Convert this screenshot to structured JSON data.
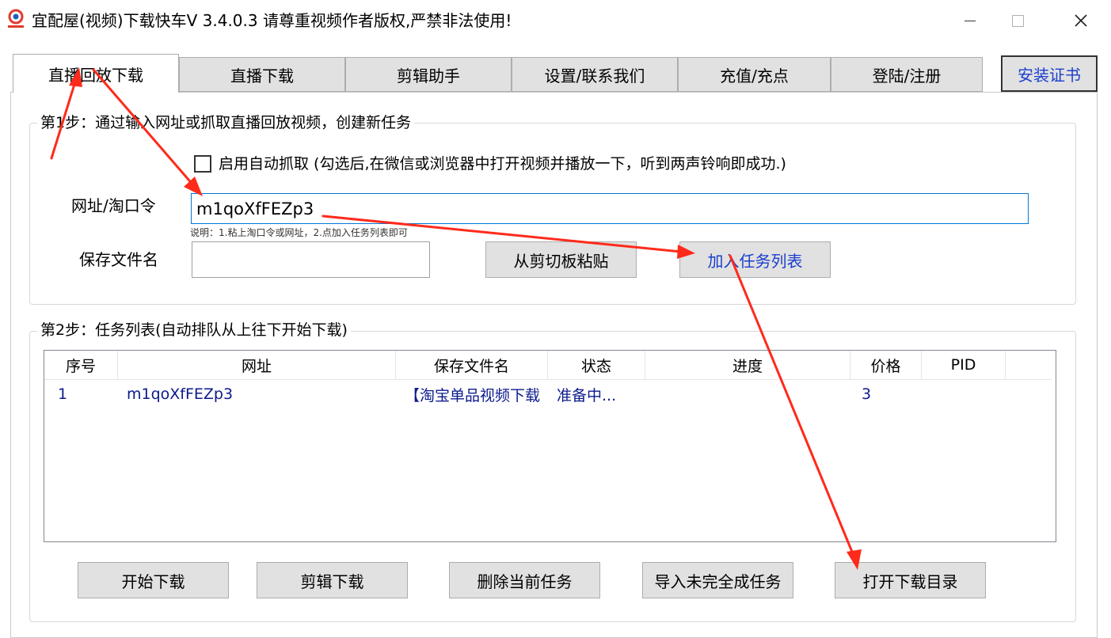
{
  "window": {
    "title": "宜配屋(视频)下载快车V 3.4.0.3 请尊重视频作者版权,严禁非法使用!",
    "minimize_glyph": "—",
    "maximize_glyph": "☐",
    "close_glyph": "✕"
  },
  "tabs": [
    {
      "label": "直播回放下载",
      "active": true
    },
    {
      "label": "直播下载",
      "active": false
    },
    {
      "label": "剪辑助手",
      "active": false
    },
    {
      "label": "设置/联系我们",
      "active": false
    },
    {
      "label": "充值/充点",
      "active": false
    },
    {
      "label": "登陆/注册",
      "active": false
    }
  ],
  "install_cert_label": "安装证书",
  "step1": {
    "legend": "第1步：通过输入网址或抓取直播回放视频，创建新任务",
    "auto_capture_label": "启用自动抓取 (勾选后,在微信或浏览器中打开视频并播放一下，听到两声铃响即成功.)",
    "auto_capture_checked": false,
    "url_label": "网址/淘口令",
    "url_value": "m1qoXfFEZp3",
    "hint": "说明：1.粘上淘口令或网址，2.点加入任务列表即可",
    "filename_label": "保存文件名",
    "filename_value": "",
    "paste_button": "从剪切板粘贴",
    "add_task_button": "加入任务列表"
  },
  "step2": {
    "legend": "第2步：任务列表(自动排队从上往下开始下载)",
    "columns": [
      "序号",
      "网址",
      "保存文件名",
      "状态",
      "进度",
      "价格",
      "PID"
    ],
    "rows": [
      {
        "index": "1",
        "url": "m1qoXfFEZp3",
        "filename": "【淘宝单品视频下载",
        "status": "准备中...",
        "progress": "",
        "price": "3",
        "pid": ""
      }
    ],
    "buttons": {
      "start": "开始下载",
      "clip": "剪辑下载",
      "delete": "删除当前任务",
      "import": "导入未完全成任务",
      "open_dir": "打开下载目录"
    }
  },
  "colors": {
    "annotation_arrow": "#ff2a1a",
    "link_blue": "#1a3fcf",
    "list_text": "#0b1a8c",
    "tab_bg": "#e1e1e1"
  }
}
